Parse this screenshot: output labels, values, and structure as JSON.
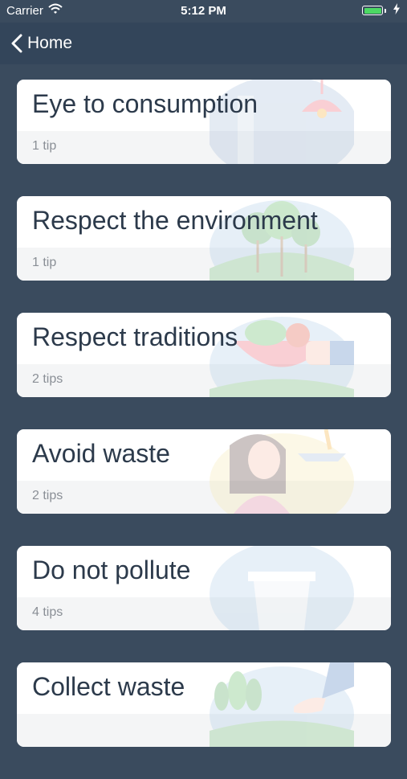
{
  "status_bar": {
    "carrier": "Carrier",
    "time": "5:12 PM",
    "wifi_icon": "wifi-icon",
    "battery_icon": "battery-icon",
    "charging_icon": "bolt-icon"
  },
  "nav": {
    "back_icon": "chevron-left-icon",
    "back_label": "Home"
  },
  "colors": {
    "background": "#3a4b5e",
    "nav_bar": "#33455a",
    "card": "#ffffff",
    "card_footer": "#f4f5f6",
    "title_text": "#2c3a4b",
    "tips_text": "#8a8f96",
    "battery": "#4cd964"
  },
  "categories": [
    {
      "title": "Eye to consumption",
      "tips": "1 tip",
      "illustration": "lamp-illustration"
    },
    {
      "title": "Respect the environment",
      "tips": "1 tip",
      "illustration": "trees-illustration"
    },
    {
      "title": "Respect traditions",
      "tips": "2 tips",
      "illustration": "food-bowl-illustration"
    },
    {
      "title": "Avoid waste",
      "tips": "2 tips",
      "illustration": "thinking-woman-illustration"
    },
    {
      "title": "Do not pollute",
      "tips": "4 tips",
      "illustration": "container-illustration"
    },
    {
      "title": "Collect waste",
      "tips": "",
      "illustration": "plant-hand-illustration"
    }
  ]
}
